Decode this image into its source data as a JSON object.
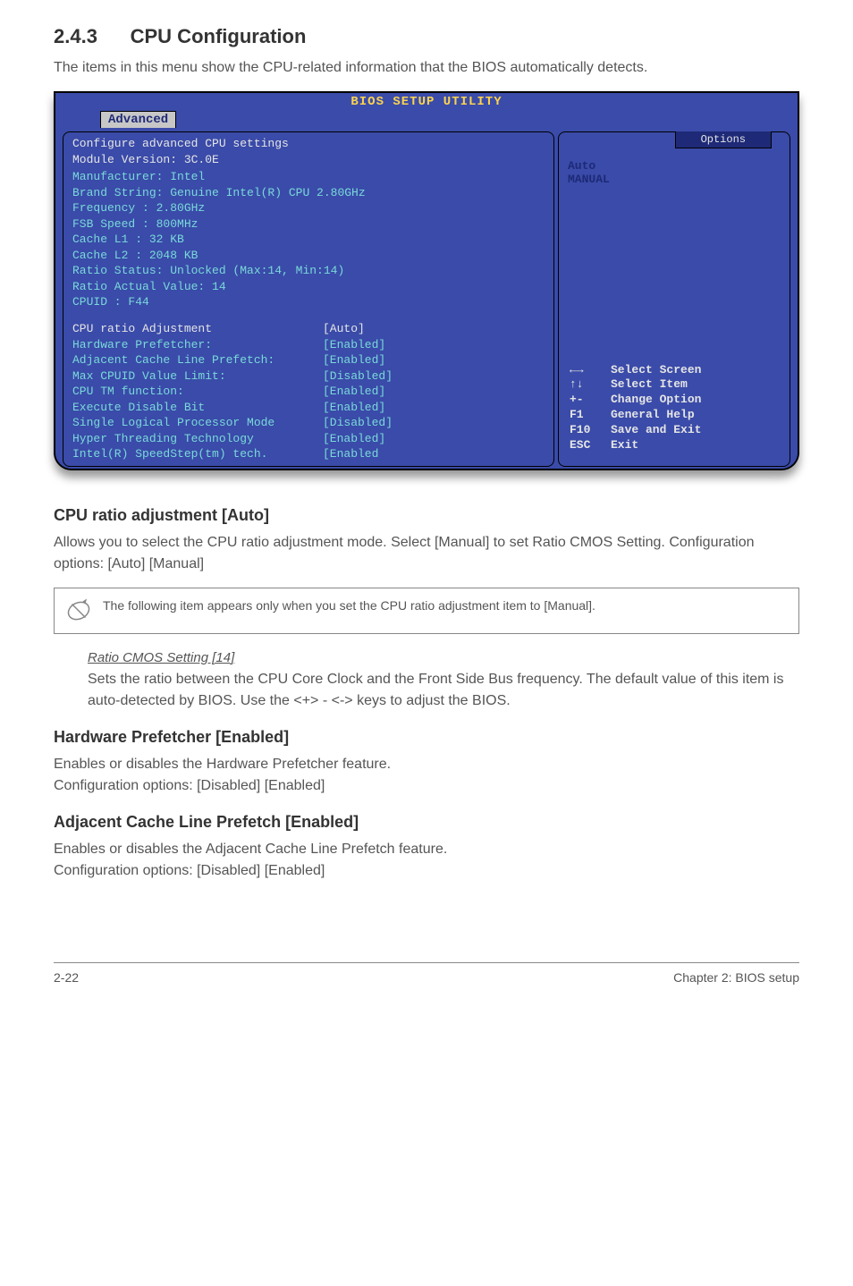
{
  "section": {
    "number": "2.4.3",
    "title": "CPU Configuration",
    "intro": "The items in this menu show the CPU-related information that the BIOS automatically detects."
  },
  "bios": {
    "title": "BIOS SETUP UTILITY",
    "tab": "Advanced",
    "header1": "Configure advanced CPU settings",
    "header2": "Module Version: 3C.0E",
    "info": [
      "Manufacturer: Intel",
      "Brand String: Genuine Intel(R) CPU 2.80GHz",
      "Frequency   : 2.80GHz",
      "FSB Speed   : 800MHz",
      "Cache L1    : 32 KB",
      "Cache L2    : 2048 KB",
      "Ratio Status: Unlocked (Max:14, Min:14)",
      "Ratio Actual Value: 14",
      "CPUID       : F44"
    ],
    "settings": [
      {
        "label": "CPU ratio Adjustment",
        "value": "[Auto]",
        "highlight": true
      },
      {
        "label": "Hardware Prefetcher:",
        "value": "[Enabled]"
      },
      {
        "label": "Adjacent Cache Line Prefetch:",
        "value": "[Enabled]"
      },
      {
        "label": "Max CPUID Value Limit:",
        "value": "[Disabled]"
      },
      {
        "label": "CPU TM function:",
        "value": "[Enabled]"
      },
      {
        "label": "Execute Disable Bit",
        "value": "[Enabled]"
      },
      {
        "label": "Single Logical Processor Mode",
        "value": "[Disabled]"
      },
      {
        "label": "Hyper Threading Technology",
        "value": "[Enabled]"
      },
      {
        "label": "Intel(R) SpeedStep(tm) tech.",
        "value": "[Enabled"
      }
    ],
    "options_title": "Options",
    "options": [
      "Auto",
      "MANUAL"
    ],
    "keys": [
      {
        "sym": "←→",
        "text": "Select Screen"
      },
      {
        "sym": "↑↓",
        "text": "Select Item"
      },
      {
        "sym": "+-",
        "text": "Change Option"
      },
      {
        "sym": "F1",
        "text": "General Help"
      },
      {
        "sym": "F10",
        "text": "Save and Exit"
      },
      {
        "sym": "ESC",
        "text": "Exit"
      }
    ]
  },
  "cpu_ratio": {
    "heading": "CPU ratio adjustment [Auto]",
    "text": "Allows you to select the CPU ratio adjustment mode. Select [Manual] to set Ratio CMOS Setting. Configuration options: [Auto] [Manual]"
  },
  "note": {
    "text": "The following item appears only when you set the CPU ratio adjustment item to [Manual]."
  },
  "ratio_cmos": {
    "title": "Ratio CMOS Setting [14]",
    "text": "Sets the ratio between the CPU Core Clock and the Front Side Bus frequency. The default value of this item is auto-detected by BIOS. Use the <+> - <-> keys to adjust the BIOS."
  },
  "hardware_prefetch": {
    "heading": "Hardware Prefetcher [Enabled]",
    "text1": "Enables or disables the Hardware Prefetcher feature.",
    "text2": "Configuration options: [Disabled] [Enabled]"
  },
  "adjacent_cache": {
    "heading": "Adjacent Cache Line Prefetch [Enabled]",
    "text1": "Enables or disables the Adjacent Cache Line Prefetch feature.",
    "text2": "Configuration options: [Disabled] [Enabled]"
  },
  "footer": {
    "left": "2-22",
    "right": "Chapter 2: BIOS setup"
  }
}
